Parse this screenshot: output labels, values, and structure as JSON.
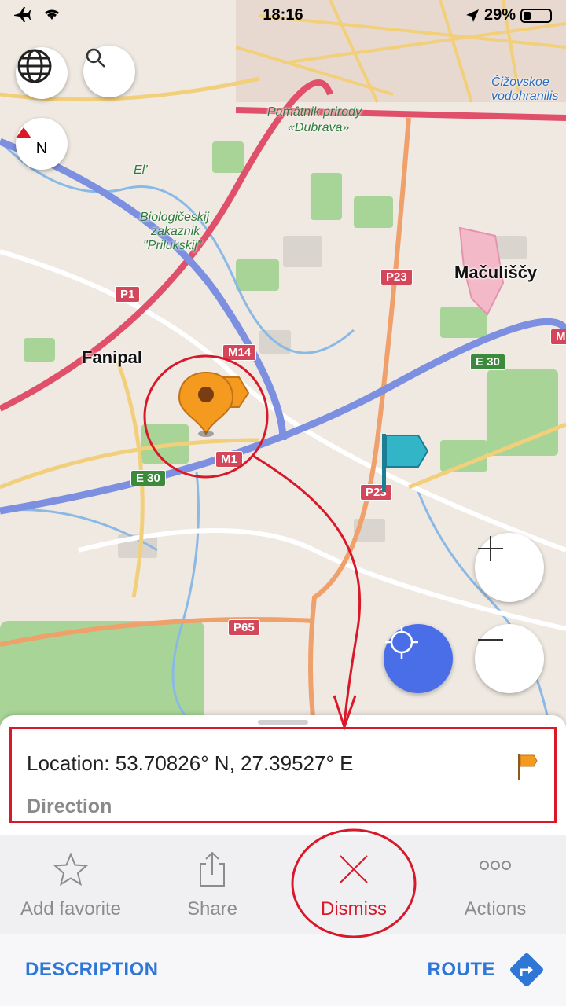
{
  "status": {
    "time": "18:16",
    "battery": "29%"
  },
  "map": {
    "places": {
      "fanipal": "Fanipal",
      "maculiscy": "Mačuliščy",
      "ciz": "Čižovskoe",
      "cizsub": "vodohranilis",
      "pamatnik": "Pamâtnik prirody",
      "dubrava": "«Dubrava»",
      "el": "El’",
      "bio1": "Biologičeskij",
      "bio2": "zakaznik",
      "bio3": "\"Prilukskij\""
    },
    "shields": {
      "p1": "P1",
      "m14": "M14",
      "m1": "M1",
      "e30a": "E 30",
      "e30b": "E 30",
      "p23a": "P23",
      "p23b": "P23",
      "p65": "P65",
      "m_edge": "M"
    },
    "compass": "N"
  },
  "sheet": {
    "location": "Location: 53.70826° N, 27.39527° E",
    "direction": "Direction"
  },
  "actions": [
    {
      "label": "Add favorite",
      "icon": "star-icon"
    },
    {
      "label": "Share",
      "icon": "share-icon"
    },
    {
      "label": "Dismiss",
      "icon": "close-icon"
    },
    {
      "label": "Actions",
      "icon": "more-icon"
    }
  ],
  "bottom": {
    "description": "DESCRIPTION",
    "route": "ROUTE"
  },
  "colors": {
    "accent": "#2f77d6",
    "dismiss": "#d9182a",
    "marker": "#f39a1f",
    "flag": "#33b5c8"
  }
}
